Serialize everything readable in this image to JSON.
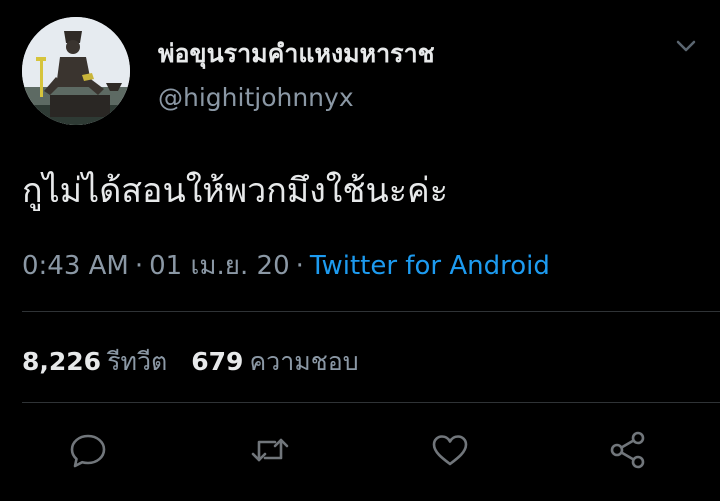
{
  "author": {
    "display_name": "พ่อขุนรามคำแหงมหาราช",
    "handle": "@highitjohnnyx",
    "avatar_icon": "statue-avatar"
  },
  "tweet": {
    "text": "กูไม่ได้สอนให้พวกมึงใช้นะค่ะ",
    "time": "0:43 AM",
    "date": "01 เม.ย. 20",
    "separator": "·",
    "source": "Twitter for Android"
  },
  "stats": {
    "retweets_count": "8,226",
    "retweets_label": "รีทวีต",
    "likes_count": "679",
    "likes_label": "ความชอบ"
  },
  "actions": [
    "reply-icon",
    "retweet-icon",
    "like-icon",
    "share-icon"
  ],
  "colors": {
    "background": "#000000",
    "primary_text": "#e7e9ea",
    "secondary_text": "#8b98a5",
    "accent": "#1d9bf0",
    "divider": "#2f3336"
  }
}
